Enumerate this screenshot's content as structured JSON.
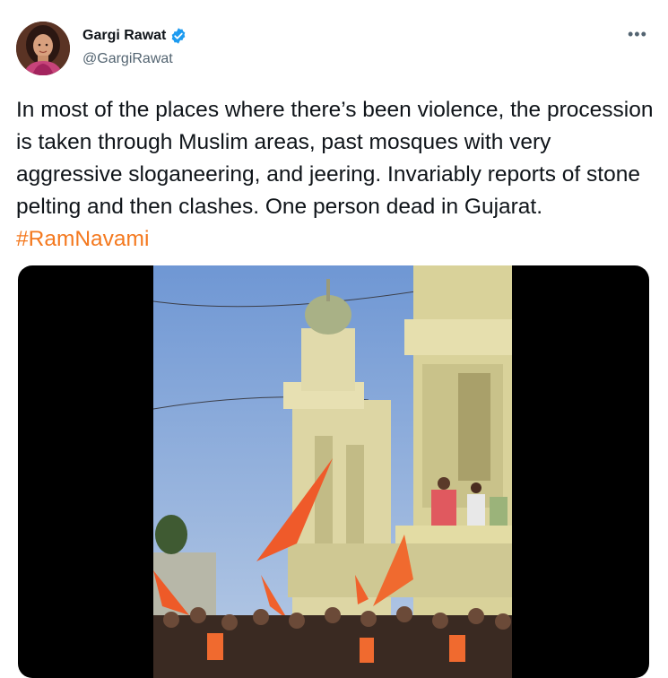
{
  "author": {
    "display_name": "Gargi Rawat",
    "handle": "@GargiRawat",
    "verified_icon": "verified-badge-icon",
    "avatar_icon": "profile-photo"
  },
  "more_label": "•••",
  "tweet": {
    "text": "In most of the places where there’s been violence, the procession is taken through Muslim areas, past mosques with very aggressive sloganeering, and jeering. Invariably reports of stone pelting and then clashes. One person dead in Gujarat. ",
    "hashtag": "#RamNavami"
  },
  "colors": {
    "hashtag": "#f4791f",
    "verified": "#1d9bf0",
    "secondary_text": "#536471"
  },
  "media": {
    "type": "video",
    "description_icon": "video-thumbnail"
  }
}
